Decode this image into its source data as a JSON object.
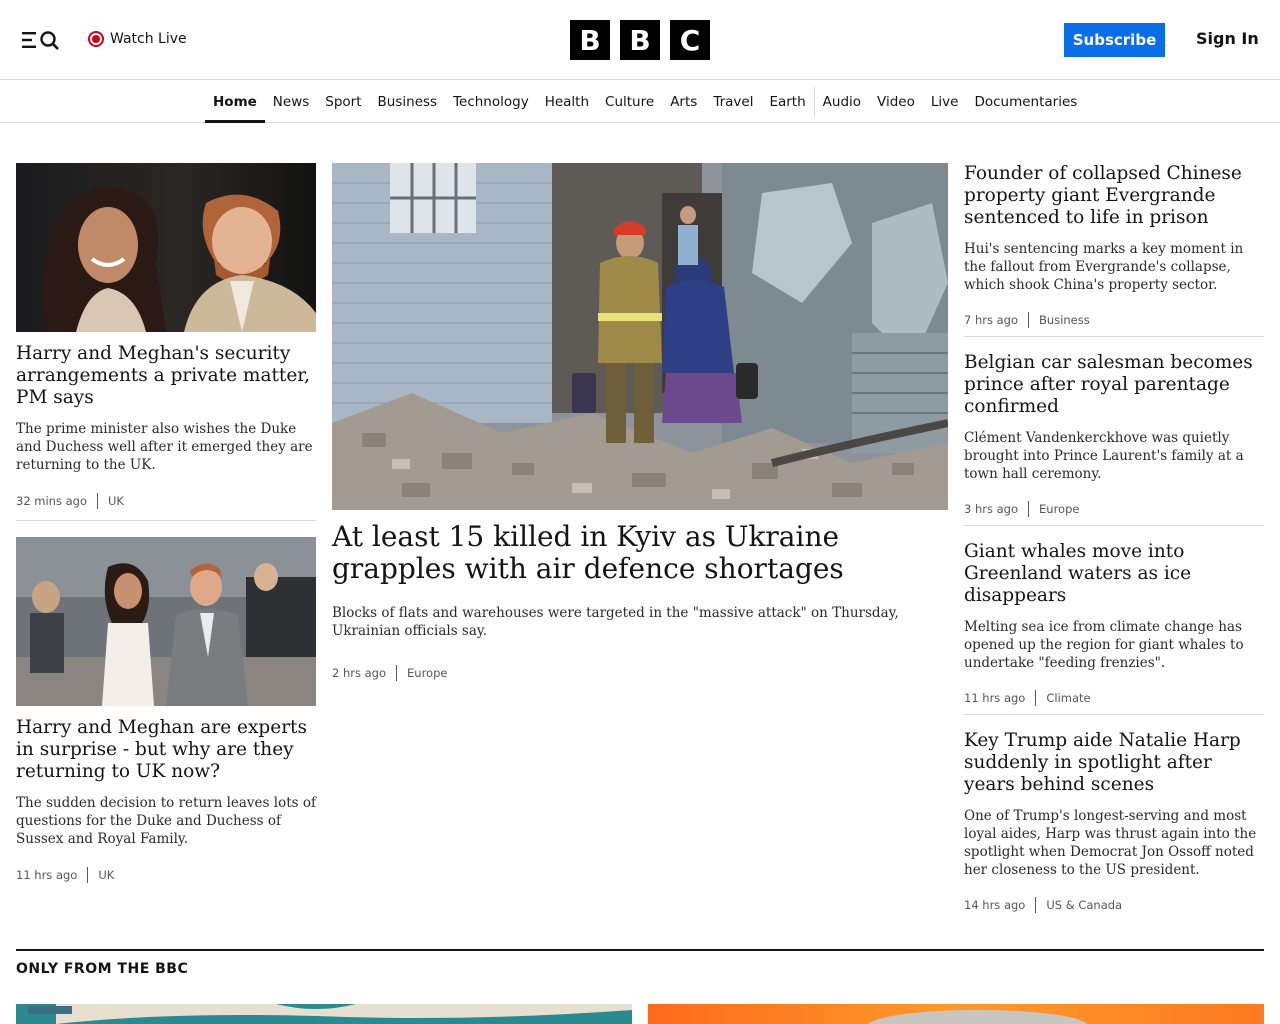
{
  "header": {
    "watch_live": "Watch Live",
    "logo_letters": [
      "B",
      "B",
      "C"
    ],
    "subscribe_label": "Subscribe",
    "signin_label": "Sign In",
    "accent_color": "#0a6ee6",
    "live_color": "#d0021b"
  },
  "nav": {
    "items": [
      {
        "label": "Home",
        "active": true
      },
      {
        "label": "News"
      },
      {
        "label": "Sport"
      },
      {
        "label": "Business"
      },
      {
        "label": "Technology"
      },
      {
        "label": "Health"
      },
      {
        "label": "Culture"
      },
      {
        "label": "Arts"
      },
      {
        "label": "Travel"
      },
      {
        "label": "Earth"
      },
      {
        "label": "Audio"
      },
      {
        "label": "Video"
      },
      {
        "label": "Live"
      },
      {
        "label": "Documentaries"
      }
    ]
  },
  "left": [
    {
      "headline": "Harry and Meghan's security arrangements a private matter, PM says",
      "summary": "The prime minister also wishes the Duke and Duchess well after it emerged they are returning to the UK.",
      "time": "32 mins ago",
      "section": "UK"
    },
    {
      "headline": "Harry and Meghan are experts in surprise - but why are they returning to UK now?",
      "summary": "The sudden decision to return leaves lots of questions for the Duke and Duchess of Sussex and Royal Family.",
      "time": "11 hrs ago",
      "section": "UK"
    }
  ],
  "center": {
    "headline": "At least 15 killed in Kyiv as Ukraine grapples with air defence shortages",
    "summary": "Blocks of flats and warehouses were targeted in the \"massive attack\" on Thursday, Ukrainian officials say.",
    "time": "2 hrs ago",
    "section": "Europe"
  },
  "right": [
    {
      "headline": "Founder of collapsed Chinese property giant Evergrande sentenced to life in prison",
      "summary": "Hui's sentencing marks a key moment in the fallout from Evergrande's collapse, which shook China's property sector.",
      "time": "7 hrs ago",
      "section": "Business"
    },
    {
      "headline": "Belgian car salesman becomes prince after royal parentage confirmed",
      "summary": "Clément Vandenkerckhove was quietly brought into Prince Laurent's family at a town hall ceremony.",
      "time": "3 hrs ago",
      "section": "Europe"
    },
    {
      "headline": "Giant whales move into Greenland waters as ice disappears",
      "summary": "Melting sea ice from climate change has opened up the region for giant whales to undertake \"feeding frenzies\".",
      "time": "11 hrs ago",
      "section": "Climate"
    },
    {
      "headline": "Key Trump aide Natalie Harp suddenly in spotlight after years behind scenes",
      "summary": "One of Trump's longest-serving and most loyal aides, Harp was thrust again into the spotlight when Democrat Jon Ossoff noted her closeness to the US president.",
      "time": "14 hrs ago",
      "section": "US & Canada"
    }
  ],
  "only_from": {
    "title": "ONLY FROM THE BBC"
  }
}
